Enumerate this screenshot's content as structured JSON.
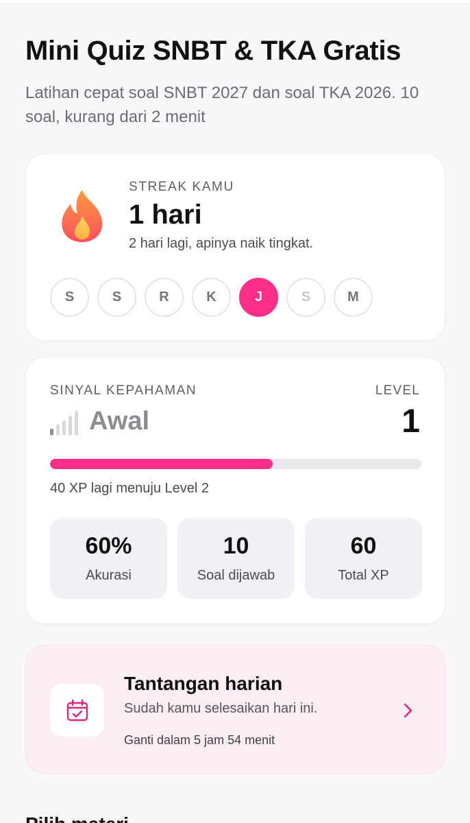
{
  "header": {
    "title": "Mini Quiz SNBT & TKA Gratis",
    "subtitle": "Latihan cepat soal SNBT 2027 dan soal TKA 2026. 10 soal, kurang dari 2 menit"
  },
  "streak": {
    "label": "STREAK KAMU",
    "value": "1 hari",
    "hint": "2 hari lagi, apinya naik tingkat.",
    "icon": "flame-icon",
    "days": [
      {
        "label": "S",
        "state": "past"
      },
      {
        "label": "S",
        "state": "past"
      },
      {
        "label": "R",
        "state": "past"
      },
      {
        "label": "K",
        "state": "past"
      },
      {
        "label": "J",
        "state": "active"
      },
      {
        "label": "S",
        "state": "future"
      },
      {
        "label": "M",
        "state": "past"
      }
    ]
  },
  "signal": {
    "label": "SINYAL KEPAHAMAN",
    "value": "Awal",
    "level_label": "LEVEL",
    "level_value": "1",
    "progress_fraction": 0.6,
    "xp_hint": "40 XP lagi menuju Level 2",
    "stats": [
      {
        "value": "60%",
        "label": "Akurasi"
      },
      {
        "value": "10",
        "label": "Soal dijawab"
      },
      {
        "value": "60",
        "label": "Total XP"
      }
    ]
  },
  "challenge": {
    "title": "Tantangan harian",
    "desc": "Sudah kamu selesaikan hari ini.",
    "time": "Ganti dalam 5 jam 54 menit",
    "icon": "calendar-check-icon"
  },
  "next_section": {
    "title": "Pilih materi"
  },
  "colors": {
    "accent": "#ff2e88",
    "challenge_bg": "#fdeef4",
    "muted_text": "#6b6b73"
  }
}
